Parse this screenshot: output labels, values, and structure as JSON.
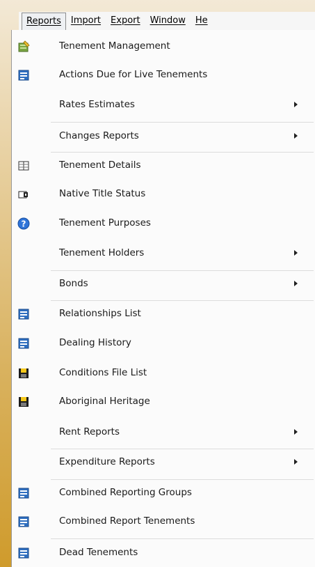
{
  "menubar": {
    "items": [
      "Reports",
      "Import",
      "Export",
      "Window",
      "He"
    ]
  },
  "menu": {
    "items": [
      {
        "label": "Tenement Management",
        "icon": "tenement-management-icon",
        "submenu": false
      },
      {
        "label": "Actions Due for Live Tenements",
        "icon": "report-icon",
        "submenu": false
      },
      {
        "label": "Rates Estimates",
        "icon": null,
        "submenu": true
      },
      {
        "label": "Changes Reports",
        "icon": null,
        "submenu": true
      },
      {
        "label": "Tenement Details",
        "icon": "details-icon",
        "submenu": false
      },
      {
        "label": "Native Title Status",
        "icon": "native-title-icon",
        "submenu": false
      },
      {
        "label": "Tenement Purposes",
        "icon": "help-icon",
        "submenu": false
      },
      {
        "label": "Tenement Holders",
        "icon": null,
        "submenu": true
      },
      {
        "label": "Bonds",
        "icon": null,
        "submenu": true
      },
      {
        "label": "Relationships List",
        "icon": "report-icon",
        "submenu": false
      },
      {
        "label": "Dealing History",
        "icon": "report-icon",
        "submenu": false
      },
      {
        "label": "Conditions File List",
        "icon": "save-icon",
        "submenu": false
      },
      {
        "label": "Aboriginal Heritage",
        "icon": "save-icon",
        "submenu": false
      },
      {
        "label": "Rent Reports",
        "icon": null,
        "submenu": true
      },
      {
        "label": "Expenditure Reports",
        "icon": null,
        "submenu": true
      },
      {
        "label": "Combined Reporting Groups",
        "icon": "report-icon",
        "submenu": false
      },
      {
        "label": "Combined Report Tenements",
        "icon": "report-icon",
        "submenu": false
      },
      {
        "label": "Dead Tenements",
        "icon": "report-icon",
        "submenu": false
      }
    ]
  }
}
